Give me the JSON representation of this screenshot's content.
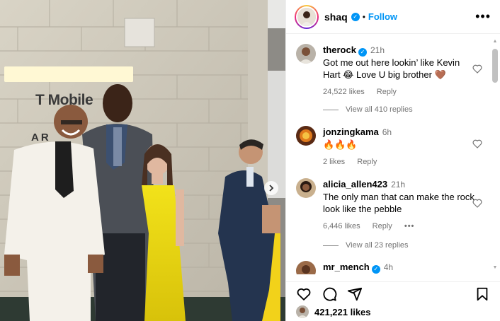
{
  "post": {
    "photo_sign_text": "T Mobile",
    "photo_sign_sub": "AR"
  },
  "header": {
    "username": "shaq",
    "separator": "•",
    "follow_label": "Follow",
    "more_icon": "more-options-icon"
  },
  "comments": [
    {
      "username": "therock",
      "verified": true,
      "time": "21h",
      "text": "Got me out here lookin’ like Kevin Hart 😂 Love U big brother 🤎",
      "likes": "24,522 likes",
      "reply_label": "Reply",
      "view_replies": "View all 410 replies"
    },
    {
      "username": "jonzingkama",
      "verified": false,
      "time": "6h",
      "text": "🔥🔥🔥",
      "likes": "2 likes",
      "reply_label": "Reply"
    },
    {
      "username": "alicia_allen423",
      "verified": false,
      "time": "21h",
      "text": "The only man that can make the rock look like the pebble",
      "likes": "6,446 likes",
      "reply_label": "Reply",
      "more_dots": "•••",
      "view_replies": "View all 23 replies"
    },
    {
      "username": "mr_mench",
      "verified": true,
      "time": "4h",
      "text": ""
    }
  ],
  "actions": {
    "icons": [
      "heart-icon",
      "comment-icon",
      "share-icon",
      "bookmark-icon"
    ]
  },
  "likes_total": "421,221 likes",
  "colors": {
    "accent": "#0095f6",
    "muted": "#737373",
    "border": "#efefef"
  }
}
